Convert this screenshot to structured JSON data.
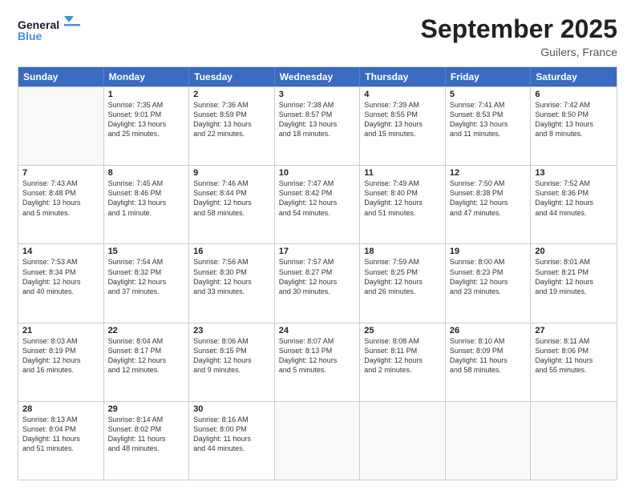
{
  "header": {
    "logo_general": "General",
    "logo_blue": "Blue",
    "month": "September 2025",
    "location": "Guilers, France"
  },
  "weekdays": [
    "Sunday",
    "Monday",
    "Tuesday",
    "Wednesday",
    "Thursday",
    "Friday",
    "Saturday"
  ],
  "weeks": [
    [
      {
        "day": "",
        "info": ""
      },
      {
        "day": "1",
        "info": "Sunrise: 7:35 AM\nSunset: 9:01 PM\nDaylight: 13 hours\nand 25 minutes."
      },
      {
        "day": "2",
        "info": "Sunrise: 7:36 AM\nSunset: 8:59 PM\nDaylight: 13 hours\nand 22 minutes."
      },
      {
        "day": "3",
        "info": "Sunrise: 7:38 AM\nSunset: 8:57 PM\nDaylight: 13 hours\nand 18 minutes."
      },
      {
        "day": "4",
        "info": "Sunrise: 7:39 AM\nSunset: 8:55 PM\nDaylight: 13 hours\nand 15 minutes."
      },
      {
        "day": "5",
        "info": "Sunrise: 7:41 AM\nSunset: 8:53 PM\nDaylight: 13 hours\nand 11 minutes."
      },
      {
        "day": "6",
        "info": "Sunrise: 7:42 AM\nSunset: 8:50 PM\nDaylight: 13 hours\nand 8 minutes."
      }
    ],
    [
      {
        "day": "7",
        "info": "Sunrise: 7:43 AM\nSunset: 8:48 PM\nDaylight: 13 hours\nand 5 minutes."
      },
      {
        "day": "8",
        "info": "Sunrise: 7:45 AM\nSunset: 8:46 PM\nDaylight: 13 hours\nand 1 minute."
      },
      {
        "day": "9",
        "info": "Sunrise: 7:46 AM\nSunset: 8:44 PM\nDaylight: 12 hours\nand 58 minutes."
      },
      {
        "day": "10",
        "info": "Sunrise: 7:47 AM\nSunset: 8:42 PM\nDaylight: 12 hours\nand 54 minutes."
      },
      {
        "day": "11",
        "info": "Sunrise: 7:49 AM\nSunset: 8:40 PM\nDaylight: 12 hours\nand 51 minutes."
      },
      {
        "day": "12",
        "info": "Sunrise: 7:50 AM\nSunset: 8:38 PM\nDaylight: 12 hours\nand 47 minutes."
      },
      {
        "day": "13",
        "info": "Sunrise: 7:52 AM\nSunset: 8:36 PM\nDaylight: 12 hours\nand 44 minutes."
      }
    ],
    [
      {
        "day": "14",
        "info": "Sunrise: 7:53 AM\nSunset: 8:34 PM\nDaylight: 12 hours\nand 40 minutes."
      },
      {
        "day": "15",
        "info": "Sunrise: 7:54 AM\nSunset: 8:32 PM\nDaylight: 12 hours\nand 37 minutes."
      },
      {
        "day": "16",
        "info": "Sunrise: 7:56 AM\nSunset: 8:30 PM\nDaylight: 12 hours\nand 33 minutes."
      },
      {
        "day": "17",
        "info": "Sunrise: 7:57 AM\nSunset: 8:27 PM\nDaylight: 12 hours\nand 30 minutes."
      },
      {
        "day": "18",
        "info": "Sunrise: 7:59 AM\nSunset: 8:25 PM\nDaylight: 12 hours\nand 26 minutes."
      },
      {
        "day": "19",
        "info": "Sunrise: 8:00 AM\nSunset: 8:23 PM\nDaylight: 12 hours\nand 23 minutes."
      },
      {
        "day": "20",
        "info": "Sunrise: 8:01 AM\nSunset: 8:21 PM\nDaylight: 12 hours\nand 19 minutes."
      }
    ],
    [
      {
        "day": "21",
        "info": "Sunrise: 8:03 AM\nSunset: 8:19 PM\nDaylight: 12 hours\nand 16 minutes."
      },
      {
        "day": "22",
        "info": "Sunrise: 8:04 AM\nSunset: 8:17 PM\nDaylight: 12 hours\nand 12 minutes."
      },
      {
        "day": "23",
        "info": "Sunrise: 8:06 AM\nSunset: 8:15 PM\nDaylight: 12 hours\nand 9 minutes."
      },
      {
        "day": "24",
        "info": "Sunrise: 8:07 AM\nSunset: 8:13 PM\nDaylight: 12 hours\nand 5 minutes."
      },
      {
        "day": "25",
        "info": "Sunrise: 8:08 AM\nSunset: 8:11 PM\nDaylight: 12 hours\nand 2 minutes."
      },
      {
        "day": "26",
        "info": "Sunrise: 8:10 AM\nSunset: 8:09 PM\nDaylight: 11 hours\nand 58 minutes."
      },
      {
        "day": "27",
        "info": "Sunrise: 8:11 AM\nSunset: 8:06 PM\nDaylight: 11 hours\nand 55 minutes."
      }
    ],
    [
      {
        "day": "28",
        "info": "Sunrise: 8:13 AM\nSunset: 8:04 PM\nDaylight: 11 hours\nand 51 minutes."
      },
      {
        "day": "29",
        "info": "Sunrise: 8:14 AM\nSunset: 8:02 PM\nDaylight: 11 hours\nand 48 minutes."
      },
      {
        "day": "30",
        "info": "Sunrise: 8:16 AM\nSunset: 8:00 PM\nDaylight: 11 hours\nand 44 minutes."
      },
      {
        "day": "",
        "info": ""
      },
      {
        "day": "",
        "info": ""
      },
      {
        "day": "",
        "info": ""
      },
      {
        "day": "",
        "info": ""
      }
    ]
  ]
}
